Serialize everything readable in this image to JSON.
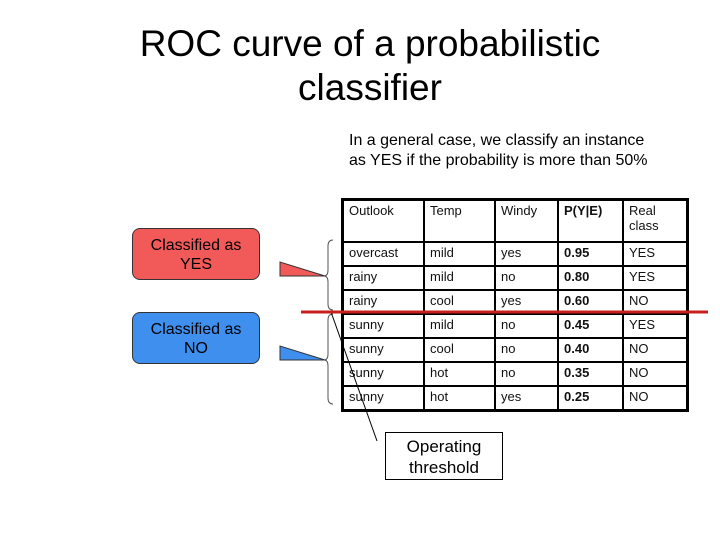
{
  "slide": {
    "title_line1": "ROC curve of a probabilistic",
    "title_line2": "classifier",
    "intro": "In a general case, we classify an instance as YES if the probability is more than 50%"
  },
  "callouts": {
    "yes": {
      "line1": "Classified as",
      "line2": "YES",
      "color": "#f25a5a"
    },
    "no": {
      "line1": "Classified as",
      "line2": "NO",
      "color": "#3f8fef"
    }
  },
  "threshold": {
    "line1": "Operating",
    "line2": "threshold",
    "line_color": "#c81e1e"
  },
  "table": {
    "headers": [
      "Outlook",
      "Temp",
      "Windy",
      "P(Y|E)",
      "Real class"
    ],
    "rows": [
      [
        "overcast",
        "mild",
        "yes",
        "0.95",
        "YES"
      ],
      [
        "rainy",
        "mild",
        "no",
        "0.80",
        "YES"
      ],
      [
        "rainy",
        "cool",
        "yes",
        "0.60",
        "NO"
      ],
      [
        "sunny",
        "mild",
        "no",
        "0.45",
        "YES"
      ],
      [
        "sunny",
        "cool",
        "no",
        "0.40",
        "NO"
      ],
      [
        "sunny",
        "hot",
        "no",
        "0.35",
        "NO"
      ],
      [
        "sunny",
        "hot",
        "yes",
        "0.25",
        "NO"
      ]
    ]
  }
}
